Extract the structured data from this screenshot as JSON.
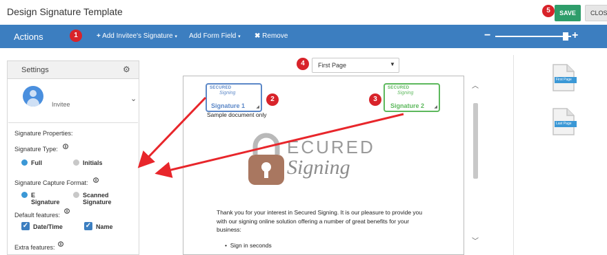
{
  "app": {
    "title": "Design Signature Template",
    "save_label": "SAVE",
    "close_label": "CLOSE"
  },
  "actionbar": {
    "title": "Actions",
    "items": [
      {
        "icon": "plus-icon",
        "label": "Add Invitee's Signature",
        "has_caret": true
      },
      {
        "icon": "",
        "label": "Add Form Field",
        "has_caret": true
      },
      {
        "icon": "x-icon",
        "label": "Remove",
        "has_caret": false
      }
    ],
    "zoom_minus": "−",
    "zoom_plus": "+",
    "zoom_level": 0.88
  },
  "badges": [
    "1",
    "2",
    "3",
    "4",
    "5"
  ],
  "settings": {
    "title": "Settings",
    "invitee_label": "Invitee",
    "signature_properties": "Signature Properties:",
    "signature_type_label": "Signature Type:",
    "signature_type_options": [
      {
        "label": "Full",
        "selected": true
      },
      {
        "label": "Initials",
        "selected": false
      }
    ],
    "capture_format_label": "Signature Capture Format:",
    "capture_format_options": [
      {
        "line1": "E",
        "line2": "Signature",
        "selected": true
      },
      {
        "line1": "Scanned",
        "line2": "Signature",
        "selected": false
      }
    ],
    "default_features_label": "Default features:",
    "default_features": [
      {
        "label": "Date/Time",
        "checked": true
      },
      {
        "label": "Name",
        "checked": true
      }
    ],
    "extra_features_label": "Extra features:"
  },
  "page_select": {
    "value": "First Page"
  },
  "document": {
    "signature_boxes": [
      {
        "label": "Signature 1",
        "logo_top": "SECURED",
        "logo_bottom": "Signing",
        "color": "#5b87c7"
      },
      {
        "label": "Signature 2",
        "logo_top": "SECURED",
        "logo_bottom": "Signing",
        "color": "#5cb85c"
      }
    ],
    "sample_text": "Sample document only",
    "logo_top": "ECURED",
    "logo_bottom": "Signing",
    "paragraph_lines": [
      "Thank you for your interest in Secured Signing. It is our pleasure to provide you",
      "with our signing online solution offering a number of great benefits for your",
      "business:"
    ],
    "bullets": [
      "Sign in seconds"
    ]
  },
  "thumbnails": [
    {
      "label": "First Page"
    },
    {
      "label": "Last Page"
    }
  ],
  "colors": {
    "actionbar": "#3c7ec0",
    "badge": "#d8232a",
    "save": "#2e9d6a",
    "arrow": "#e8262b",
    "radio_on": "#3b98d6"
  }
}
